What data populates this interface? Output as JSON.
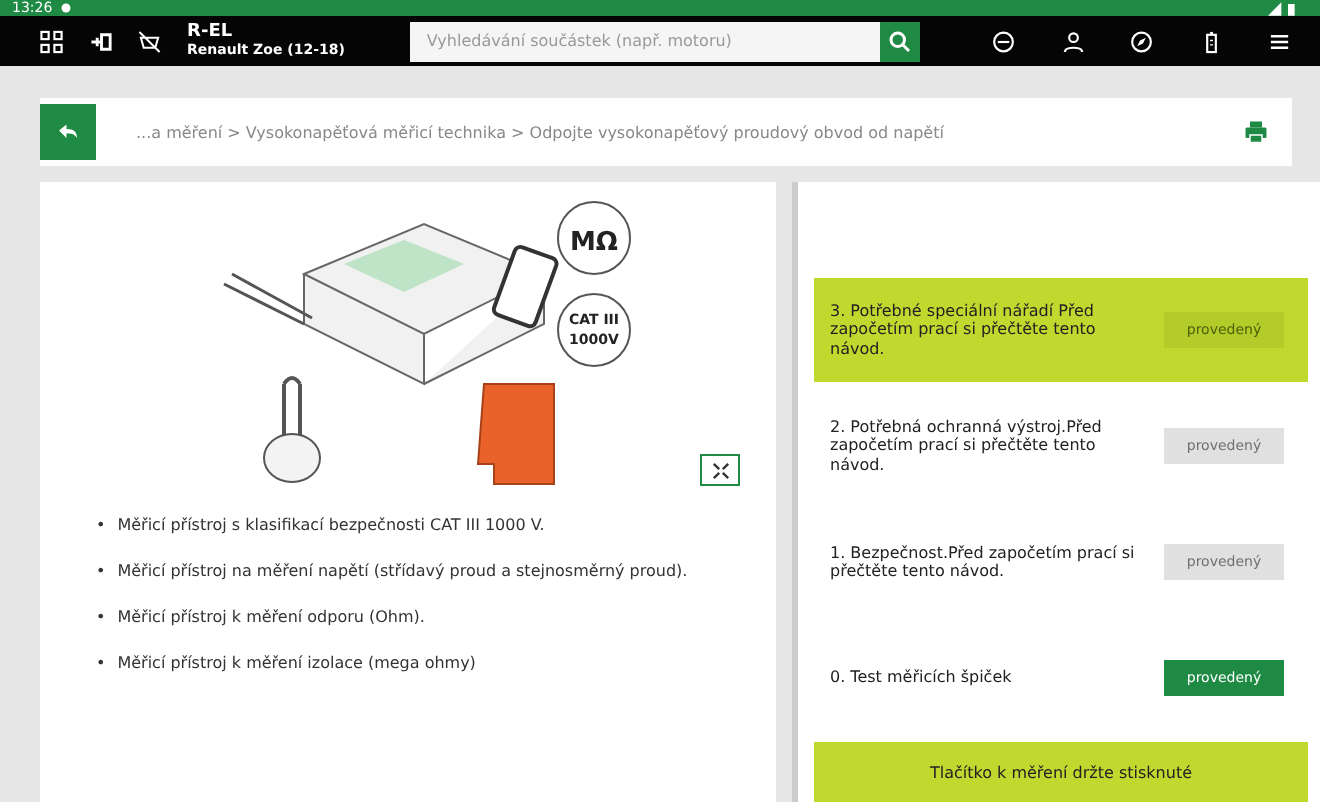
{
  "status_bar": {
    "time": "13:26"
  },
  "header": {
    "title": "R-EL",
    "subtitle": "Renault Zoe (12-18)",
    "search": {
      "placeholder": "Vyhledávání součástek (např. motoru)"
    }
  },
  "breadcrumb": "...a měření > Vysokonapěťová měřicí technika > Odpojte vysokonapěťový proudový obvod od napětí",
  "illustration": {
    "labels": [
      "MΩ",
      "CAT III",
      "1000V"
    ]
  },
  "bullets": [
    {
      "marker": "•",
      "text": "Měřicí přístroj s klasifikací bezpečnosti CAT III 1000 V."
    },
    {
      "marker": "•",
      "text": "Měřicí přístroj na měření napětí (střídavý proud a stejnosměrný proud)."
    },
    {
      "marker": "•",
      "text": "Měřicí přístroj k měření odporu (Ohm)."
    },
    {
      "marker": "•",
      "text": "Měřicí přístroj k měření izolace (mega ohmy)"
    }
  ],
  "steps": [
    {
      "text": "3. Potřebné speciální nářadí Před započetím prací si přečtěte tento návod.",
      "selected": true,
      "button": "provedený",
      "disabled": true
    },
    {
      "text": "2. Potřebná ochranná výstroj.Před započetím prací si přečtěte tento návod.",
      "selected": false,
      "button": "provedený",
      "disabled": true
    },
    {
      "text": "1. Bezpečnost.Před započetím prací si přečtěte tento návod.",
      "selected": false,
      "button": "provedený",
      "disabled": true
    },
    {
      "text": "0. Test měřicích špiček",
      "selected": false,
      "button": "provedený",
      "disabled": false
    }
  ],
  "footer_button": "Tlačítko k měření držte stisknuté"
}
